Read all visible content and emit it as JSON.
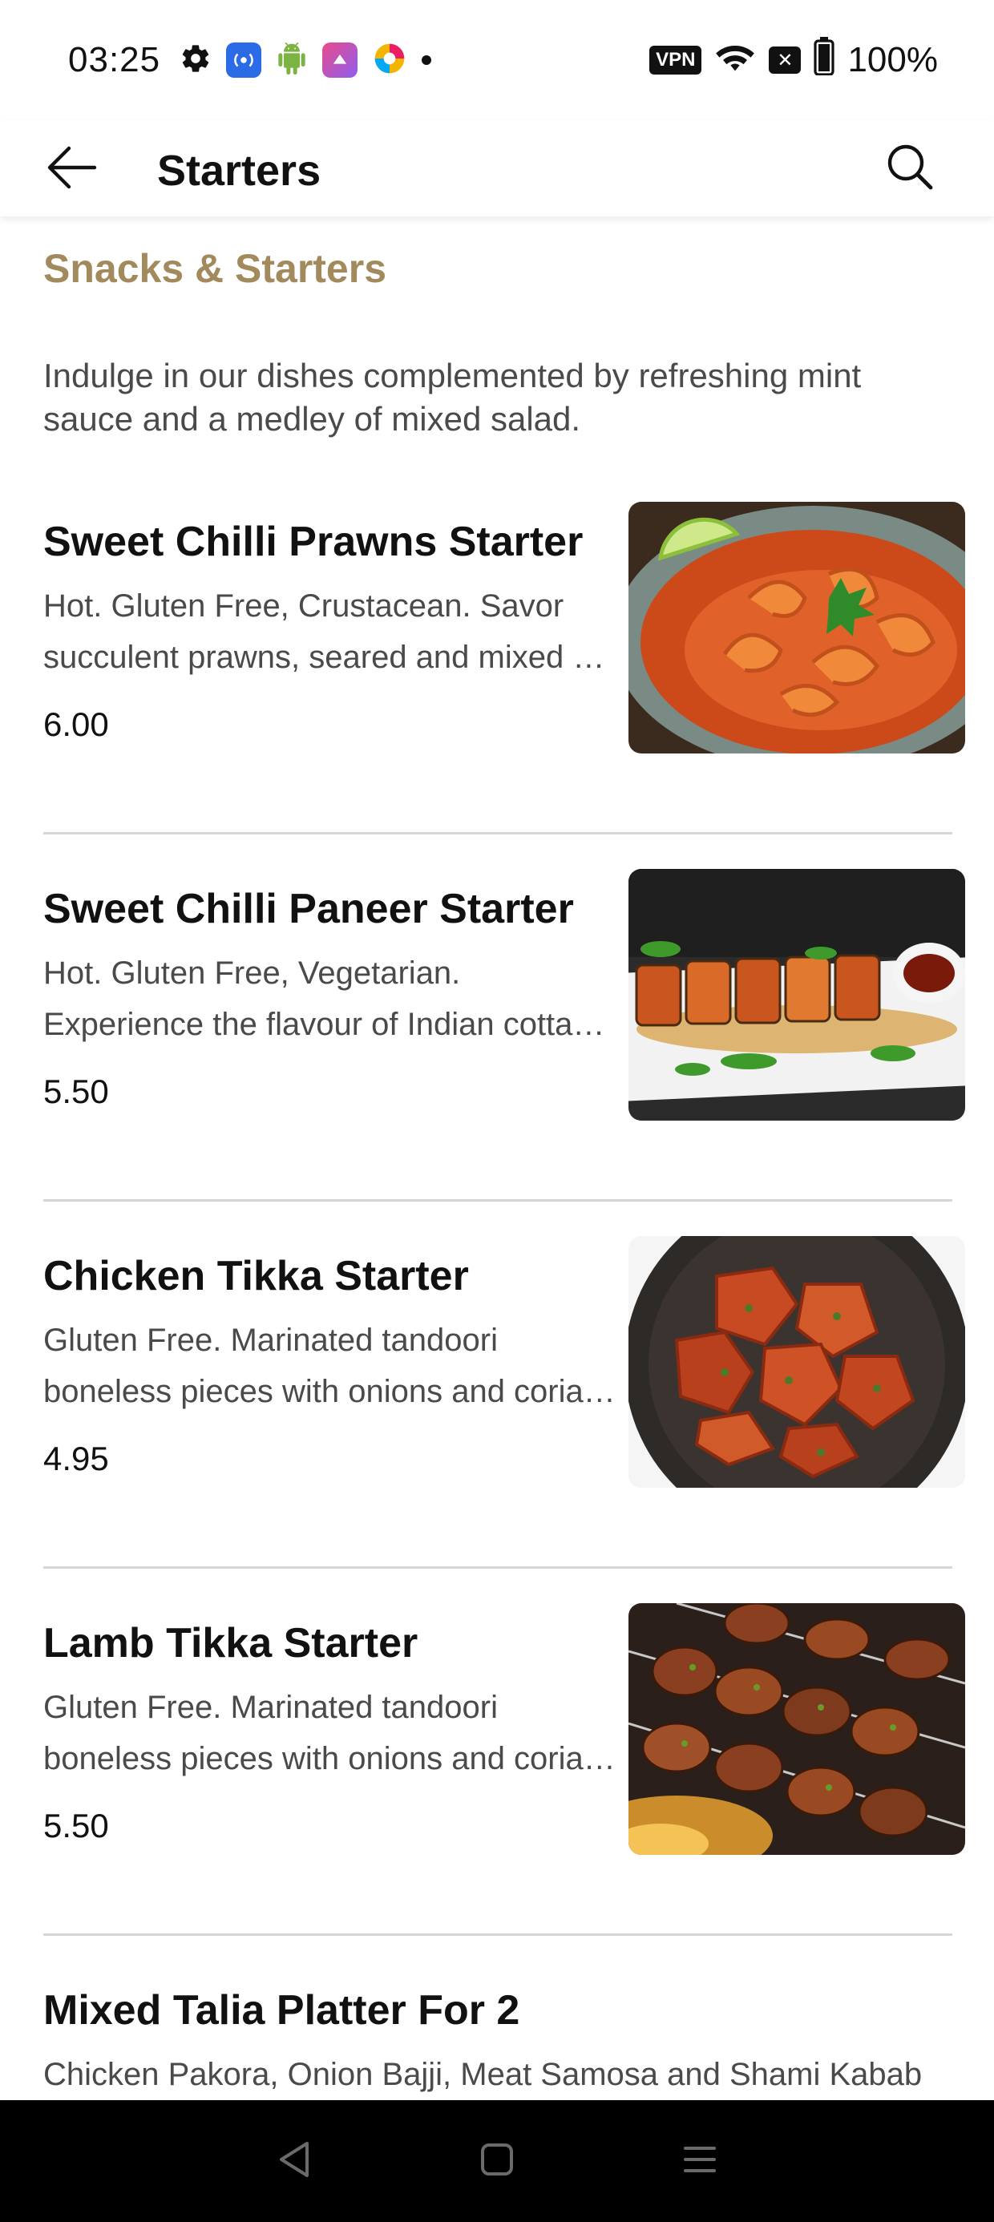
{
  "status_bar": {
    "time": "03:25",
    "vpn_label": "VPN",
    "battery": "100%",
    "icons": [
      "gear-icon",
      "radio-app-icon",
      "android-icon",
      "shortcut-app-icon",
      "color-app-icon",
      "dot-icon",
      "vpn-icon",
      "wifi-icon",
      "x-badge-icon",
      "battery-icon"
    ]
  },
  "app_bar": {
    "title": "Starters",
    "back_icon": "arrow-left-icon",
    "search_icon": "search-icon"
  },
  "section": {
    "title": "Snacks & Starters",
    "description": "Indulge in our dishes complemented by refreshing mint sauce and a medley of mixed salad."
  },
  "items": [
    {
      "name": "Sweet Chilli Prawns Starter",
      "description": "Hot. Gluten Free, Crustacean. Savor succulent prawns, seared and mixed …",
      "price": "6.00"
    },
    {
      "name": "Sweet Chilli Paneer Starter",
      "description": "Hot. Gluten Free, Vegetarian. Experience the flavour of Indian cotta…",
      "price": "5.50"
    },
    {
      "name": "Chicken Tikka Starter",
      "description": "Gluten Free. Marinated tandoori boneless pieces with onions and coria…",
      "price": "4.95"
    },
    {
      "name": "Lamb Tikka Starter",
      "description": "Gluten Free. Marinated tandoori boneless pieces with onions and coria…",
      "price": "5.50"
    },
    {
      "name": "Mixed Talia Platter For 2",
      "description": "Chicken Pakora, Onion Bajji, Meat Samosa and Shami Kabab"
    }
  ],
  "nav_bar": {
    "icons": [
      "back-triangle-icon",
      "home-square-icon",
      "recents-menu-icon"
    ]
  },
  "colors": {
    "section_title": "#a38a5c",
    "text_primary": "#111111",
    "text_secondary": "#4a4a4a",
    "divider": "#d6d6d6",
    "nav_background": "#000000"
  }
}
